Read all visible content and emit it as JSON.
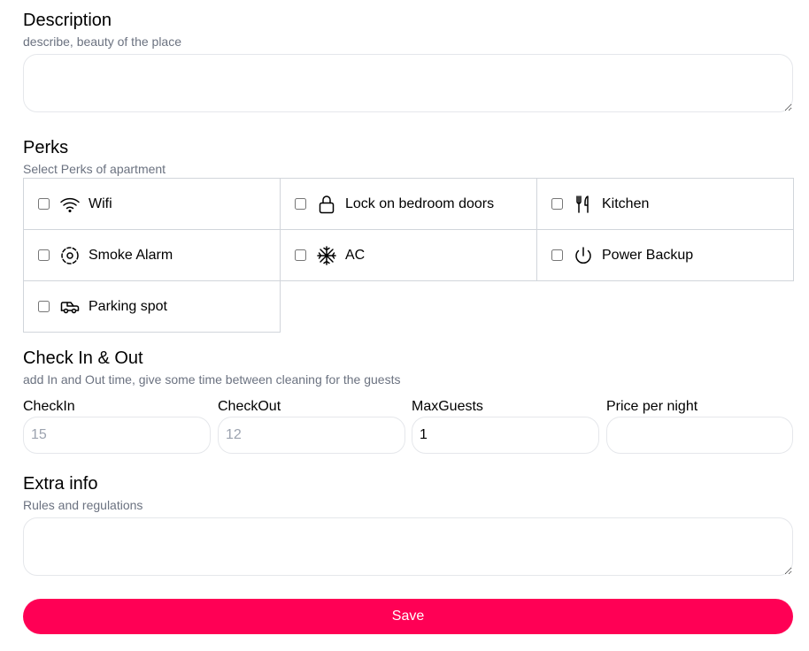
{
  "description": {
    "title": "Description",
    "subtitle": "describe, beauty of the place",
    "value": ""
  },
  "perks": {
    "title": "Perks",
    "subtitle": "Select Perks of apartment",
    "items": [
      {
        "label": "Wifi",
        "icon": "wifi-icon",
        "checked": false
      },
      {
        "label": "Lock on bedroom doors",
        "icon": "lock-icon",
        "checked": false
      },
      {
        "label": "Kitchen",
        "icon": "fork-knife-icon",
        "checked": false
      },
      {
        "label": "Smoke Alarm",
        "icon": "smoke-alarm-icon",
        "checked": false
      },
      {
        "label": "AC",
        "icon": "snowflake-icon",
        "checked": false
      },
      {
        "label": "Power Backup",
        "icon": "power-icon",
        "checked": false
      },
      {
        "label": "Parking spot",
        "icon": "car-icon",
        "checked": false
      }
    ]
  },
  "checkinout": {
    "title": "Check In & Out",
    "subtitle": "add In and Out time, give some time between cleaning for the guests",
    "fields": [
      {
        "label": "CheckIn",
        "value": "",
        "placeholder": "15"
      },
      {
        "label": "CheckOut",
        "value": "",
        "placeholder": "12"
      },
      {
        "label": "MaxGuests",
        "value": "1",
        "placeholder": ""
      },
      {
        "label": "Price per night",
        "value": "",
        "placeholder": ""
      }
    ]
  },
  "extra": {
    "title": "Extra info",
    "subtitle": "Rules and regulations",
    "value": ""
  },
  "save_label": "Save",
  "colors": {
    "accent": "#ff0055",
    "subtitle": "#6b7280",
    "border": "#e5e7eb"
  }
}
